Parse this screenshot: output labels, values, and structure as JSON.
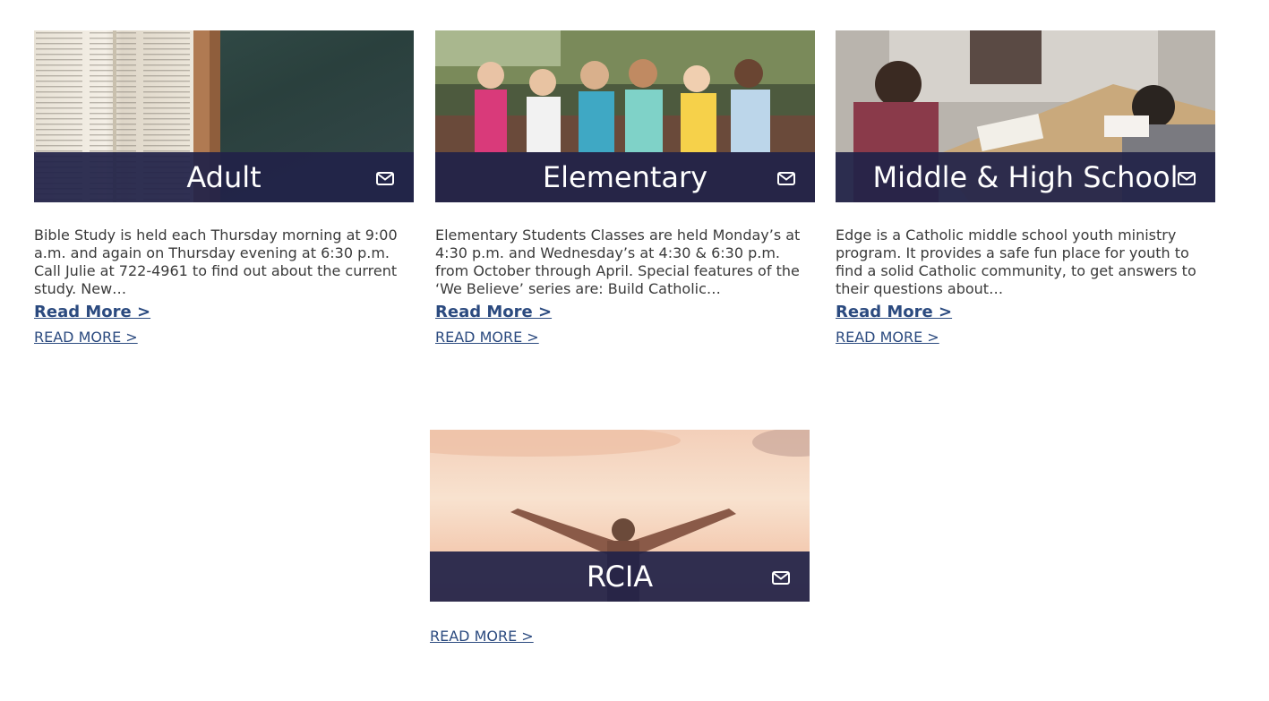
{
  "cards": [
    {
      "title": "Adult",
      "image": "open-bible-on-dark-table",
      "icon": "mail-icon",
      "excerpt": "Bible Study is held each Thursday morning at 9:00 a.m. and again on Thursday evening at 6:30 p.m. Call Julie at 722-4961 to find out about the current study.  New…",
      "read_more": "Read More >",
      "read_more_caps": "READ MORE >"
    },
    {
      "title": "Elementary",
      "image": "smiling-children-group-photo",
      "icon": "mail-icon",
      "excerpt": "Elementary Students Classes are held Monday’s at 4:30 p.m. and Wednesday’s at 4:30 & 6:30 p.m. from October through April. Special features of the ‘We Believe’ series are: Build Catholic…",
      "read_more": "Read More >",
      "read_more_caps": "READ MORE >"
    },
    {
      "title": "Middle & High School",
      "image": "students-studying-at-table",
      "icon": "mail-icon",
      "excerpt": "Edge is a Catholic middle school youth ministry program. It provides a safe fun place for youth to find a solid Catholic community, to get answers to their questions about…",
      "read_more": "Read More >",
      "read_more_caps": "READ MORE >"
    },
    {
      "title": "RCIA",
      "image": "person-arms-raised-at-sunset",
      "icon": "mail-icon",
      "read_more_caps": "READ MORE >"
    }
  ],
  "colors": {
    "title_bar": "#212248",
    "link": "#2b4a7f",
    "body_text": "#3a3a3a"
  }
}
